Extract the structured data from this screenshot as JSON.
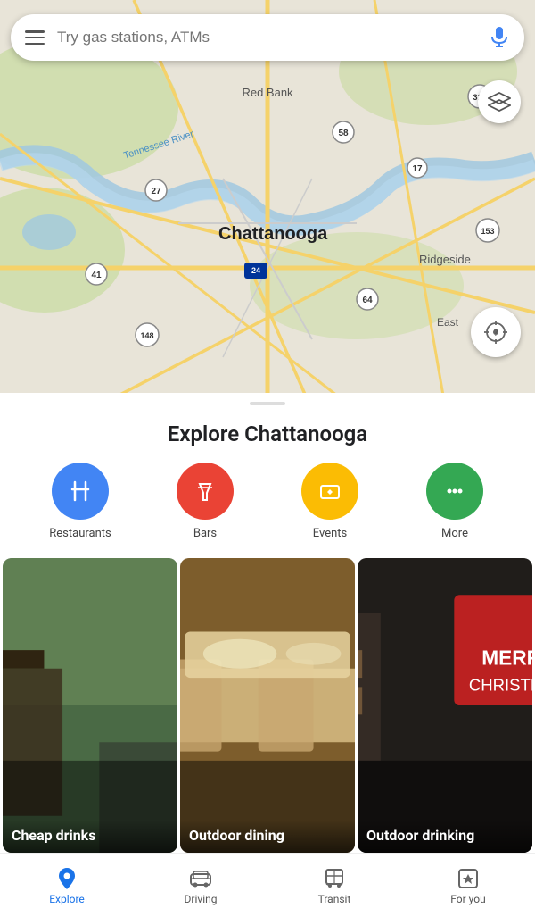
{
  "search": {
    "placeholder": "Try gas stations, ATMs"
  },
  "map": {
    "city_label": "Chattanooga",
    "area_labels": [
      "Red Bank",
      "Ridgeside",
      "East"
    ],
    "route_labels": [
      "27",
      "58",
      "17",
      "41",
      "148",
      "24",
      "64",
      "153",
      "319"
    ],
    "river_label": "Tennessee River"
  },
  "explore": {
    "title": "Explore Chattanooga",
    "categories": [
      {
        "id": "restaurants",
        "label": "Restaurants",
        "color": "#4285F4",
        "icon": "🍴"
      },
      {
        "id": "bars",
        "label": "Bars",
        "color": "#EA4335",
        "icon": "🍸"
      },
      {
        "id": "events",
        "label": "Events",
        "color": "#FBBC04",
        "icon": "🎟"
      },
      {
        "id": "more",
        "label": "More",
        "color": "#34A853",
        "icon": "···"
      }
    ],
    "tiles": [
      {
        "id": "cheap-drinks",
        "label": "Cheap drinks",
        "bg_color": "#5a7a5a"
      },
      {
        "id": "outdoor-dining",
        "label": "Outdoor dining",
        "bg_color": "#8b6a3a"
      },
      {
        "id": "outdoor-drinking",
        "label": "Outdoor drinking",
        "bg_color": "#3a3a3a"
      }
    ]
  },
  "nav": {
    "items": [
      {
        "id": "explore",
        "label": "Explore",
        "active": true
      },
      {
        "id": "driving",
        "label": "Driving",
        "active": false
      },
      {
        "id": "transit",
        "label": "Transit",
        "active": false
      },
      {
        "id": "for-you",
        "label": "For you",
        "active": false
      }
    ]
  }
}
